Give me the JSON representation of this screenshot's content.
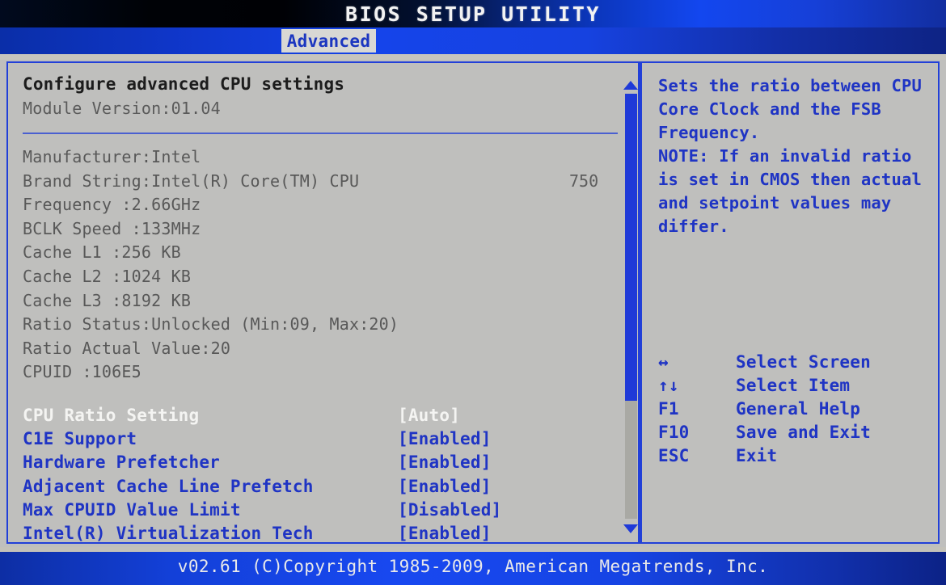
{
  "header": {
    "title": "BIOS SETUP UTILITY",
    "active_tab": "Advanced"
  },
  "main": {
    "section_title": "Configure advanced CPU settings",
    "module_version": "Module Version:01.04",
    "cpu_info": [
      {
        "label": "Manufacturer:Intel",
        "extra": ""
      },
      {
        "label": "Brand String:Intel(R) Core(TM) CPU",
        "extra": "750"
      },
      {
        "label": "Frequency    :2.66GHz",
        "extra": ""
      },
      {
        "label": "BCLK Speed   :133MHz",
        "extra": ""
      },
      {
        "label": "Cache L1     :256 KB",
        "extra": ""
      },
      {
        "label": "Cache L2     :1024 KB",
        "extra": ""
      },
      {
        "label": "Cache L3     :8192 KB",
        "extra": ""
      },
      {
        "label": "Ratio Status:Unlocked  (Min:09, Max:20)",
        "extra": ""
      },
      {
        "label": "Ratio Actual Value:20",
        "extra": ""
      },
      {
        "label": "CPUID        :106E5",
        "extra": ""
      }
    ],
    "settings": [
      {
        "name": "CPU Ratio Setting",
        "value": "[Auto]",
        "selected": true
      },
      {
        "name": "C1E Support",
        "value": "[Enabled]",
        "selected": false
      },
      {
        "name": "Hardware Prefetcher",
        "value": "[Enabled]",
        "selected": false
      },
      {
        "name": "Adjacent Cache Line Prefetch",
        "value": "[Enabled]",
        "selected": false
      },
      {
        "name": "Max CPUID Value Limit",
        "value": "[Disabled]",
        "selected": false
      },
      {
        "name": "Intel(R) Virtualization Tech",
        "value": "[Enabled]",
        "selected": false
      }
    ]
  },
  "help": {
    "text": "Sets the ratio between CPU Core Clock and the FSB Frequency.\nNOTE: If an invalid ratio is set in CMOS then actual and setpoint values may differ."
  },
  "keys": [
    {
      "symbol": "↔",
      "label": "Select Screen"
    },
    {
      "symbol": "↑↓",
      "label": "Select Item"
    },
    {
      "symbol": "F1",
      "label": "General Help"
    },
    {
      "symbol": "F10",
      "label": "Save and Exit"
    },
    {
      "symbol": "ESC",
      "label": "Exit"
    }
  ],
  "footer": {
    "text": "v02.61 (C)Copyright 1985-2009, American Megatrends, Inc."
  },
  "colors": {
    "accent_blue": "#1f34c4",
    "title_bar_blue": "#1544ea",
    "panel_bg": "#bfbfbd",
    "selected_text": "#f4f4f2",
    "info_text": "#585858"
  }
}
